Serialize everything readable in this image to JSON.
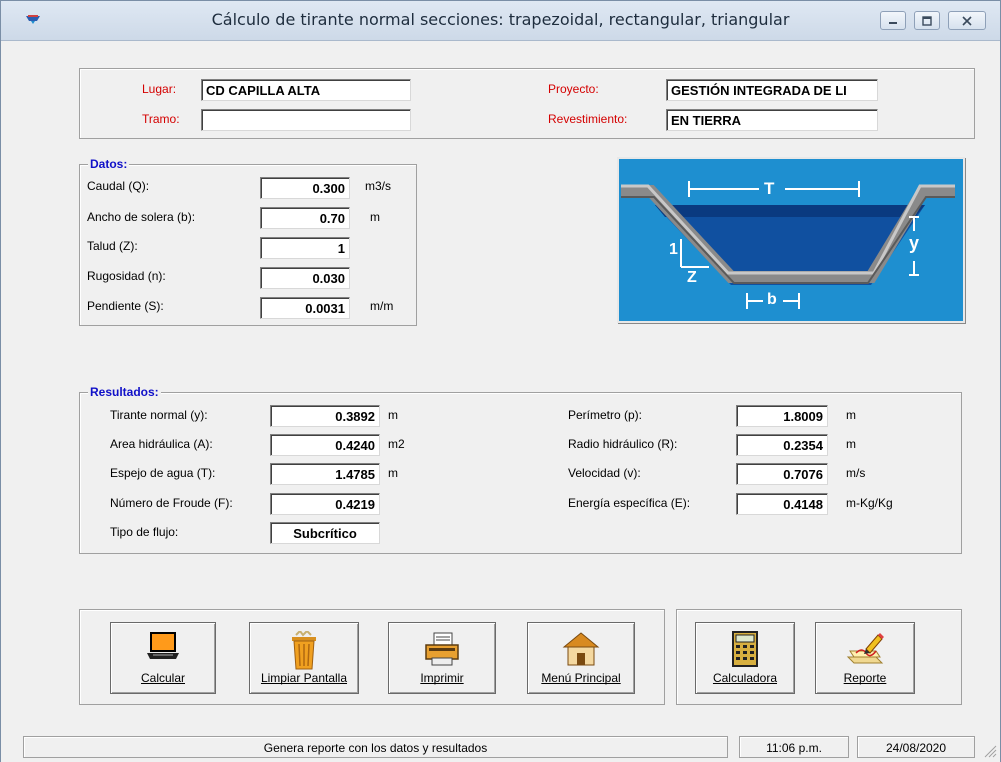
{
  "window": {
    "title": "Cálculo de tirante normal secciones: trapezoidal, rectangular, triangular"
  },
  "header": {
    "lugar_label": "Lugar:",
    "lugar_value": "CD CAPILLA ALTA",
    "tramo_label": "Tramo:",
    "tramo_value": "",
    "proyecto_label": "Proyecto:",
    "proyecto_value": "GESTIÓN INTEGRADA DE LI",
    "revestimiento_label": "Revestimiento:",
    "revestimiento_value": "EN TIERRA"
  },
  "datos": {
    "title": "Datos:",
    "rows": [
      {
        "label": "Caudal (Q):",
        "value": "0.300",
        "unit": "m3/s"
      },
      {
        "label": "Ancho de solera (b):",
        "value": "0.70",
        "unit": "m"
      },
      {
        "label": "Talud (Z):",
        "value": "1",
        "unit": ""
      },
      {
        "label": "Rugosidad (n):",
        "value": "0.030",
        "unit": ""
      },
      {
        "label": "Pendiente (S):",
        "value": "0.0031",
        "unit": "m/m"
      }
    ]
  },
  "diagram": {
    "label_T": "T",
    "label_y": "y",
    "label_1": "1",
    "label_Z": "Z",
    "label_b": "b"
  },
  "resultados": {
    "title": "Resultados:",
    "left": [
      {
        "label": "Tirante normal (y):",
        "value": "0.3892",
        "unit": "m"
      },
      {
        "label": "Area hidráulica (A):",
        "value": "0.4240",
        "unit": "m2"
      },
      {
        "label": "Espejo de agua (T):",
        "value": "1.4785",
        "unit": "m"
      },
      {
        "label": "Número de Froude (F):",
        "value": "0.4219",
        "unit": ""
      },
      {
        "label": "Tipo de flujo:",
        "value": "Subcrítico",
        "unit": ""
      }
    ],
    "right": [
      {
        "label": "Perímetro (p):",
        "value": "1.8009",
        "unit": "m"
      },
      {
        "label": "Radio hidráulico (R):",
        "value": "0.2354",
        "unit": "m"
      },
      {
        "label": "Velocidad (v):",
        "value": "0.7076",
        "unit": "m/s"
      },
      {
        "label": "Energía específica (E):",
        "value": "0.4148",
        "unit": "m-Kg/Kg"
      }
    ]
  },
  "buttons": {
    "calcular": "Calcular",
    "limpiar": "Limpiar Pantalla",
    "imprimir": "Imprimir",
    "menu": "Menú Principal",
    "calculadora": "Calculadora",
    "reporte": "Reporte"
  },
  "status": {
    "message": "Genera reporte con los datos y resultados",
    "time": "11:06 p.m.",
    "date": "24/08/2020"
  },
  "colors": {
    "label_red": "#d40000",
    "group_title_blue": "#1010c8",
    "diagram_bg": "#1e8fd0"
  }
}
